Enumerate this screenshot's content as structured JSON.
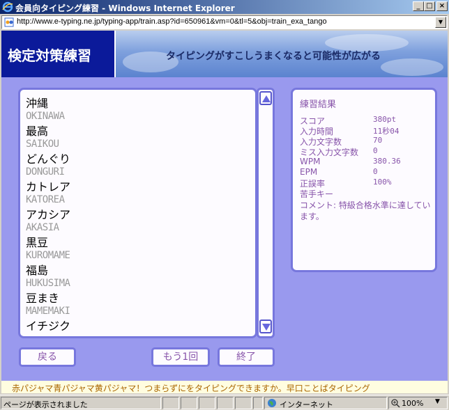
{
  "window": {
    "title": "会員向タイピング練習 - Windows Internet Explorer",
    "buttons": {
      "minimize": "_",
      "maximize": "□",
      "close": "×"
    }
  },
  "address": {
    "url": "http://www.e-typing.ne.jp/typing-app/train.asp?id=650961&vm=0&tl=5&obj=train_exa_tango"
  },
  "banner": {
    "title": "検定対策練習",
    "tagline": "タイピングがすこしうまくなると可能性が広がる"
  },
  "words": [
    {
      "jp": "沖縄",
      "romaji": "OKINAWA"
    },
    {
      "jp": "最高",
      "romaji": "SAIKOU"
    },
    {
      "jp": "どんぐり",
      "romaji": "DONGURI"
    },
    {
      "jp": "カトレア",
      "romaji": "KATOREA"
    },
    {
      "jp": "アカシア",
      "romaji": "AKASIA"
    },
    {
      "jp": "黒豆",
      "romaji": "KUROMAME"
    },
    {
      "jp": "福島",
      "romaji": "HUKUSIMA"
    },
    {
      "jp": "豆まき",
      "romaji": "MAMEMAKI"
    },
    {
      "jp": "イチジク",
      "romaji": ""
    }
  ],
  "results": {
    "title": "練習結果",
    "rows": [
      {
        "label": "スコア",
        "value": "380pt"
      },
      {
        "label": "入力時間",
        "value": "11秒04"
      },
      {
        "label": "入力文字数",
        "value": "70"
      },
      {
        "label": "ミス入力文字数",
        "value": "0"
      },
      {
        "label": "WPM",
        "value": "380.36"
      },
      {
        "label": "EPM",
        "value": "0"
      },
      {
        "label": "正誤率",
        "value": "100%"
      },
      {
        "label": "苦手キー",
        "value": ""
      }
    ],
    "comment": "コメント: 特級合格水準に達しています。"
  },
  "buttons": {
    "back": "戻る",
    "retry": "もう1回",
    "finish": "終了"
  },
  "marquee": "赤パジャマ青パジャマ黄パジャマ！つまらずにをタイピングできますか。早口ことばタイピング",
  "statusbar": {
    "text": "ページが表示されました",
    "zone": "インターネット",
    "zoom": "100%"
  },
  "colors": {
    "accent": "#7777dd",
    "banner_left": "#0b1a9a",
    "text_purple": "#8855aa",
    "background": "#9999ee"
  }
}
